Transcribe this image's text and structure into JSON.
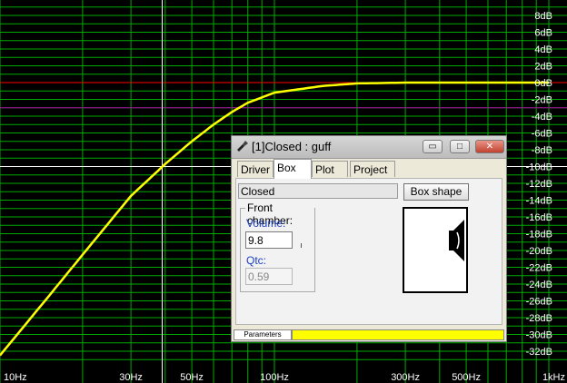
{
  "graph": {
    "y_labels": [
      "8dB",
      "6dB",
      "4dB",
      "2dB",
      "0dB",
      "-2dB",
      "-4dB",
      "-6dB",
      "-8dB",
      "-10dB",
      "-12dB",
      "-14dB",
      "-16dB",
      "-18dB",
      "-20dB",
      "-22dB",
      "-24dB",
      "-26dB",
      "-28dB",
      "-30dB",
      "-32dB"
    ],
    "x_labels": [
      "10Hz",
      "30Hz",
      "50Hz",
      "100Hz",
      "300Hz",
      "500Hz",
      "1kHz"
    ],
    "colors": {
      "background": "#000000",
      "grid": "#00aa00",
      "curve": "#ffff00",
      "zero_line": "#ff0000",
      "ref_line": "#aa00aa",
      "cursor": "#ffffff"
    }
  },
  "chart_data": {
    "type": "line",
    "title": "",
    "xlabel": "",
    "ylabel": "",
    "x_scale": "log",
    "xlim": [
      10,
      1000
    ],
    "ylim": [
      -33,
      9
    ],
    "series": [
      {
        "x": [
          10,
          15,
          20,
          30,
          40,
          50,
          60,
          70,
          80,
          100,
          150,
          200,
          300,
          500,
          1000
        ],
        "y": [
          -32.5,
          -25.5,
          -20.5,
          -13.5,
          -9.7,
          -7.0,
          -5.0,
          -3.5,
          -2.4,
          -1.2,
          -0.4,
          -0.1,
          0.0,
          0.0,
          0.0
        ]
      }
    ],
    "reference_lines_y": [
      0,
      -3,
      -10
    ],
    "cursor_x": 39
  },
  "dialog": {
    "title": "[1]Closed : guff",
    "controls": {
      "minimize": "▭",
      "restore": "□",
      "close": "✕"
    },
    "tabs": [
      "Driver",
      "Box",
      "Plot",
      "Project"
    ],
    "active_tab": "Box",
    "status": "Closed",
    "box_shape_label": "Box shape",
    "front_chamber_label": "Front chamber:",
    "volume_label": "Volume:",
    "volume_value": "9.8",
    "qtc_label": "Qtc:",
    "qtc_value": "0.59",
    "parameters_label": "Parameters"
  }
}
